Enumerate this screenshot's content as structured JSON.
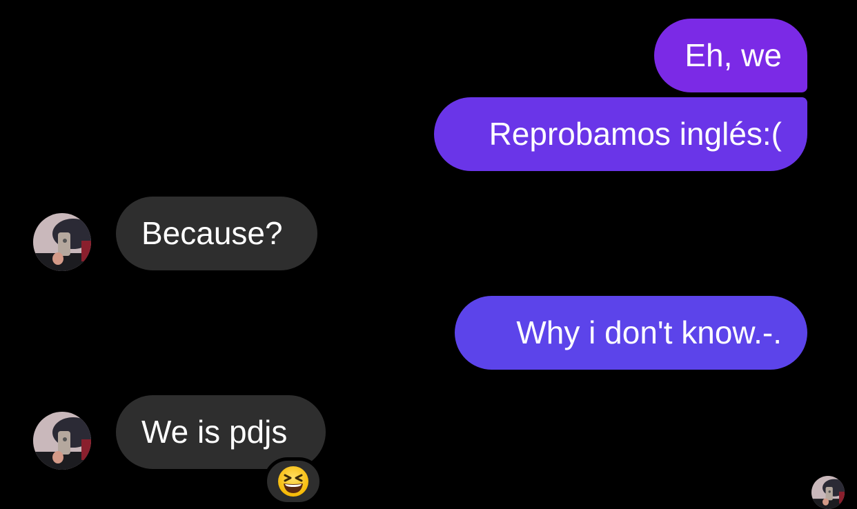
{
  "conversation": {
    "messages": [
      {
        "sender": "me",
        "text": "Eh, we"
      },
      {
        "sender": "me",
        "text": "Reprobamos inglés:("
      },
      {
        "sender": "other",
        "text": "Because?"
      },
      {
        "sender": "me",
        "text": "Why i don't know.-."
      },
      {
        "sender": "other",
        "text": "We is pdjs",
        "reaction_icon": "grinning-squinting-face-icon"
      }
    ]
  },
  "colors": {
    "background": "#000000",
    "sent_bubble_top": "#7a2ee6",
    "sent_bubble_bottom": "#5a45ea",
    "received_bubble": "#2e2e2e",
    "text": "#ffffff"
  }
}
